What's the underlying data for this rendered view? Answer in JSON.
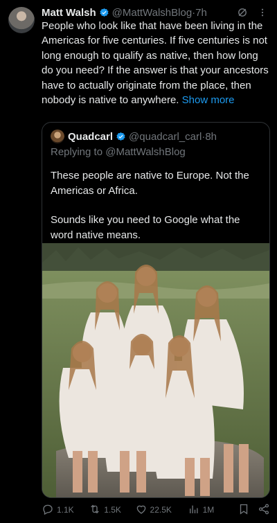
{
  "tweet": {
    "author": "Matt Walsh",
    "handle": "@MattWalshBlog",
    "time_sep": "·",
    "time": "7h",
    "text": "People who look like that have been living in the Americas for five centuries. If five centuries is not long enough to qualify as native, then how long do you need? If the answer is that your ancestors have to actually originate from the place, then nobody is native to anywhere.",
    "show_more": "Show more"
  },
  "quote": {
    "author": "Quadcarl",
    "handle": "@quadcarl_carl",
    "time_sep": "·",
    "time": "8h",
    "replying_prefix": "Replying to ",
    "replying_to": "@MattWalshBlog",
    "paragraphs": [
      "These people are native to Europe. Not the Americas or Africa.",
      "Sounds like you need to Google what the word native means."
    ]
  },
  "actions": {
    "replies": "1.1K",
    "reposts": "1.5K",
    "likes": "22.5K",
    "views": "1M"
  },
  "colors": {
    "background": "#000000",
    "text": "#e7e9ea",
    "secondary": "#71767b",
    "accent": "#1d9bf0"
  },
  "icons": [
    "verified-badge-icon",
    "grok-icon",
    "more-icon",
    "reply-icon",
    "repost-icon",
    "like-icon",
    "views-icon",
    "bookmark-icon",
    "share-icon"
  ]
}
